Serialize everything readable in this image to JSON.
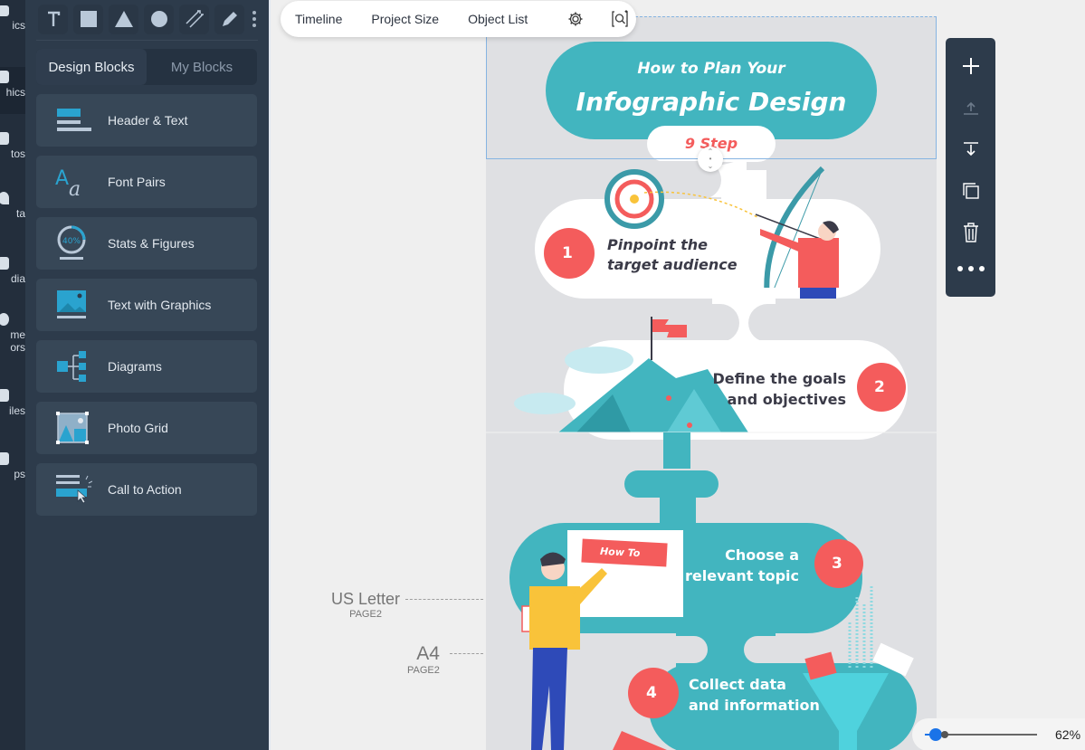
{
  "rail": {
    "items": [
      {
        "label": "ics",
        "icon": "graphics-icon"
      },
      {
        "label": "hics",
        "icon": "graphics-icon"
      },
      {
        "label": "tos",
        "icon": "photos-icon"
      },
      {
        "label": "ta",
        "icon": "data-icon"
      },
      {
        "label": "dia",
        "icon": "media-icon"
      },
      {
        "label": "me\nors",
        "icon": "theme-colors-icon"
      },
      {
        "label": "iles",
        "icon": "files-icon"
      },
      {
        "label": "ps",
        "icon": "apps-icon"
      }
    ]
  },
  "tools": [
    {
      "name": "text-tool",
      "icon": "T"
    },
    {
      "name": "rectangle-tool",
      "icon": "square"
    },
    {
      "name": "triangle-tool",
      "icon": "triangle"
    },
    {
      "name": "circle-tool",
      "icon": "circle"
    },
    {
      "name": "line-tool",
      "icon": "arrow"
    },
    {
      "name": "pen-tool",
      "icon": "pencil"
    }
  ],
  "panel": {
    "tabs": [
      {
        "label": "Design Blocks",
        "active": true
      },
      {
        "label": "My Blocks",
        "active": false
      }
    ],
    "blocks": [
      {
        "label": "Header & Text",
        "icon": "header-text-icon"
      },
      {
        "label": "Font Pairs",
        "icon": "font-pairs-icon"
      },
      {
        "label": "Stats & Figures",
        "icon": "stats-figures-icon",
        "icon_text": "40%"
      },
      {
        "label": "Text with Graphics",
        "icon": "text-graphics-icon"
      },
      {
        "label": "Diagrams",
        "icon": "diagrams-icon"
      },
      {
        "label": "Photo Grid",
        "icon": "photo-grid-icon"
      },
      {
        "label": "Call to Action",
        "icon": "call-to-action-icon"
      }
    ]
  },
  "topbar": {
    "timeline": "Timeline",
    "project_size": "Project Size",
    "object_list": "Object List",
    "settings_icon": "gear-icon",
    "search_icon": "search-canvas-icon"
  },
  "infographic": {
    "title_line1": "How to Plan Your",
    "title_line2": "Infographic Design",
    "subtitle": "9 Step",
    "steps": [
      {
        "number": "1",
        "line1": "Pinpoint the",
        "line2": "target audience"
      },
      {
        "number": "2",
        "line1": "Define the goals",
        "line2": "and objectives"
      },
      {
        "number": "3",
        "line1": "Choose a",
        "line2": "relevant topic"
      },
      {
        "number": "4",
        "line1": "Collect data",
        "line2": "and information"
      }
    ],
    "board_text": "How To",
    "colors": {
      "teal": "#42b5bf",
      "coral": "#f45c5c",
      "page": "#dfe0e3",
      "white": "#ffffff",
      "dark": "#3b3b48"
    }
  },
  "page_labels": [
    {
      "main": "US Letter",
      "sub": "PAGE2"
    },
    {
      "main": "A4",
      "sub": "PAGE2"
    }
  ],
  "right_toolbar": [
    {
      "name": "add-block-button",
      "icon": "plus-icon"
    },
    {
      "name": "move-up-button",
      "icon": "move-up-icon"
    },
    {
      "name": "move-down-button",
      "icon": "move-down-icon"
    },
    {
      "name": "duplicate-button",
      "icon": "duplicate-icon"
    },
    {
      "name": "delete-button",
      "icon": "trash-icon"
    },
    {
      "name": "more-button",
      "icon": "more-icon"
    }
  ],
  "zoom": {
    "label": "62%",
    "value": 0.62,
    "slider_fraction": 0.1
  }
}
